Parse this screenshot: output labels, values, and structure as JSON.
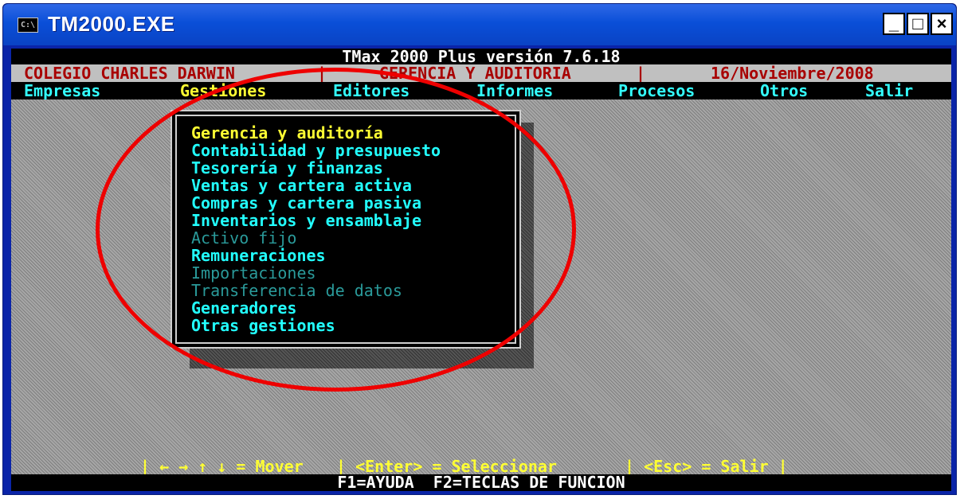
{
  "window": {
    "title": "TM2000.EXE",
    "icon_text": "C:\\",
    "min_label": "_",
    "max_label": "□",
    "close_label": "×"
  },
  "header": {
    "app_title": "TMax 2000 Plus versión 7.6.18",
    "company": "COLEGIO CHARLES DARWIN",
    "module": "GERENCIA Y AUDITORIA",
    "date": "16/Noviembre/2008",
    "separator": "|"
  },
  "menu": {
    "items": [
      "Empresas",
      "Gestiones",
      "Editores",
      "Informes",
      "Procesos",
      "Otros",
      "Salir"
    ],
    "active_index": 1
  },
  "dropdown": {
    "items": [
      {
        "label": "Gerencia y auditoría",
        "state": "selected"
      },
      {
        "label": "Contabilidad y presupuesto",
        "state": "enabled"
      },
      {
        "label": "Tesorería y finanzas",
        "state": "enabled"
      },
      {
        "label": "Ventas y cartera activa",
        "state": "enabled"
      },
      {
        "label": "Compras y cartera pasiva",
        "state": "enabled"
      },
      {
        "label": "Inventarios y ensamblaje",
        "state": "enabled"
      },
      {
        "label": "Activo fijo",
        "state": "disabled"
      },
      {
        "label": "Remuneraciones",
        "state": "enabled"
      },
      {
        "label": "Importaciones",
        "state": "disabled"
      },
      {
        "label": "Transferencia de datos",
        "state": "disabled"
      },
      {
        "label": "Generadores",
        "state": "enabled"
      },
      {
        "label": "Otras gestiones",
        "state": "enabled"
      }
    ]
  },
  "help_bar": {
    "move": "| ← → ↑ ↓ = Mover",
    "select": "| <Enter> = Seleccionar",
    "exit": "| <Esc> = Salir |"
  },
  "footer": {
    "text": "F1=AYUDA  F2=TECLAS DE FUNCION"
  },
  "colors": {
    "title_bar": "#0a4fd8",
    "menu_text": "#33ffff",
    "selected_item": "#ffff33",
    "annotation_ring": "#ee0000"
  }
}
